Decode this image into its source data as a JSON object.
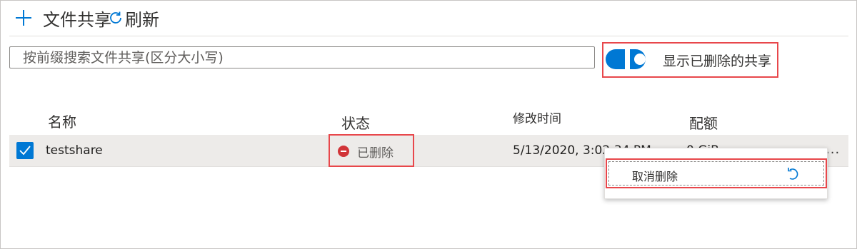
{
  "toolbar": {
    "add_label": "文件共享",
    "refresh_label": "刷新"
  },
  "search": {
    "placeholder": "按前缀搜索文件共享(区分大小写)"
  },
  "toggle": {
    "label": "显示已删除的共享",
    "state": "on"
  },
  "table": {
    "columns": {
      "name": "名称",
      "status": "状态",
      "modified": "修改时间",
      "quota": "配额"
    },
    "rows": [
      {
        "name": "testshare",
        "status": "已删除",
        "modified": "5/13/2020, 3:02:34 PM",
        "quota": "0 GiB",
        "more": "..."
      }
    ]
  },
  "context_menu": {
    "items": [
      {
        "label": "取消删除",
        "icon": "undo-icon"
      }
    ]
  },
  "colors": {
    "accent": "#0078d4",
    "highlight_border": "#e8474b",
    "deleted": "#d13438"
  }
}
